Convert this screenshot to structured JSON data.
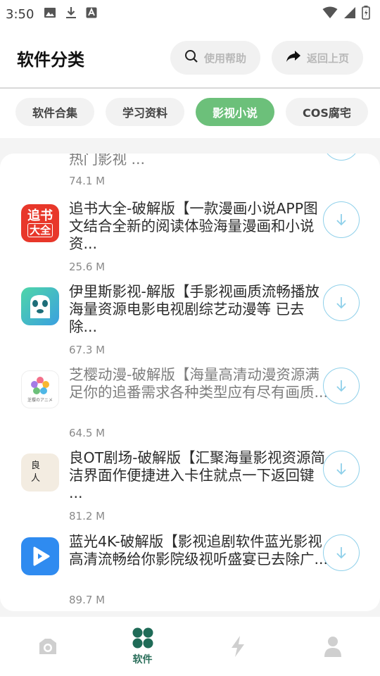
{
  "status_bar": {
    "time": "3:50"
  },
  "header": {
    "title": "软件分类",
    "help_label": "使用帮助",
    "back_label": "返回上页"
  },
  "tabs": [
    {
      "label": "软件合集",
      "active": false
    },
    {
      "label": "学习资料",
      "active": false
    },
    {
      "label": "影视小说",
      "active": true
    },
    {
      "label": "COS腐宅",
      "active": false
    }
  ],
  "list": [
    {
      "title": "热门影视 ...",
      "size": "74.1 M",
      "icon": "partial-app-icon"
    },
    {
      "title": "追书大全-破解版【一款漫画小说APP图文结合全新的阅读体验海量漫画和小说资...",
      "size": "25.6 M",
      "icon": "zhuishu-app-icon",
      "icon_text_top": "追书",
      "icon_text_bottom": "大全"
    },
    {
      "title": "伊里斯影视-解版【手影视画质流畅播放海量资源电影电视剧综艺动漫等 已去除...",
      "size": "67.3 M",
      "icon": "panda-app-icon"
    },
    {
      "title": "芝樱动漫-破解版【海量高清动漫资源满足你的追番需求各种类型应有尽有画质...",
      "size": "64.5 M",
      "icon": "flower-app-icon",
      "icon_caption": "芝樱のアニメ"
    },
    {
      "title": "良OT剧场-破解版【汇聚海量影视资源简洁界面作便捷进入卡住就点一下返回键 ...",
      "size": "81.2 M",
      "icon": "liangren-app-icon",
      "icon_text_top": "良",
      "icon_text_bottom": "人"
    },
    {
      "title": "蓝光4K-破解版【影视追剧软件蓝光影视高清流畅给你影院级视听盛宴已去除广...",
      "size": "89.7 M",
      "icon": "play-app-icon"
    }
  ],
  "bottom_nav": [
    {
      "label": "",
      "icon": "camera-icon",
      "active": false
    },
    {
      "label": "软件",
      "icon": "apps-grid-icon",
      "active": true
    },
    {
      "label": "",
      "icon": "lightning-icon",
      "active": false
    },
    {
      "label": "",
      "icon": "person-icon",
      "active": false
    }
  ],
  "colors": {
    "accent": "#6cc07a",
    "nav_active": "#2a6e5a",
    "download_ring": "#8fd0ea"
  }
}
